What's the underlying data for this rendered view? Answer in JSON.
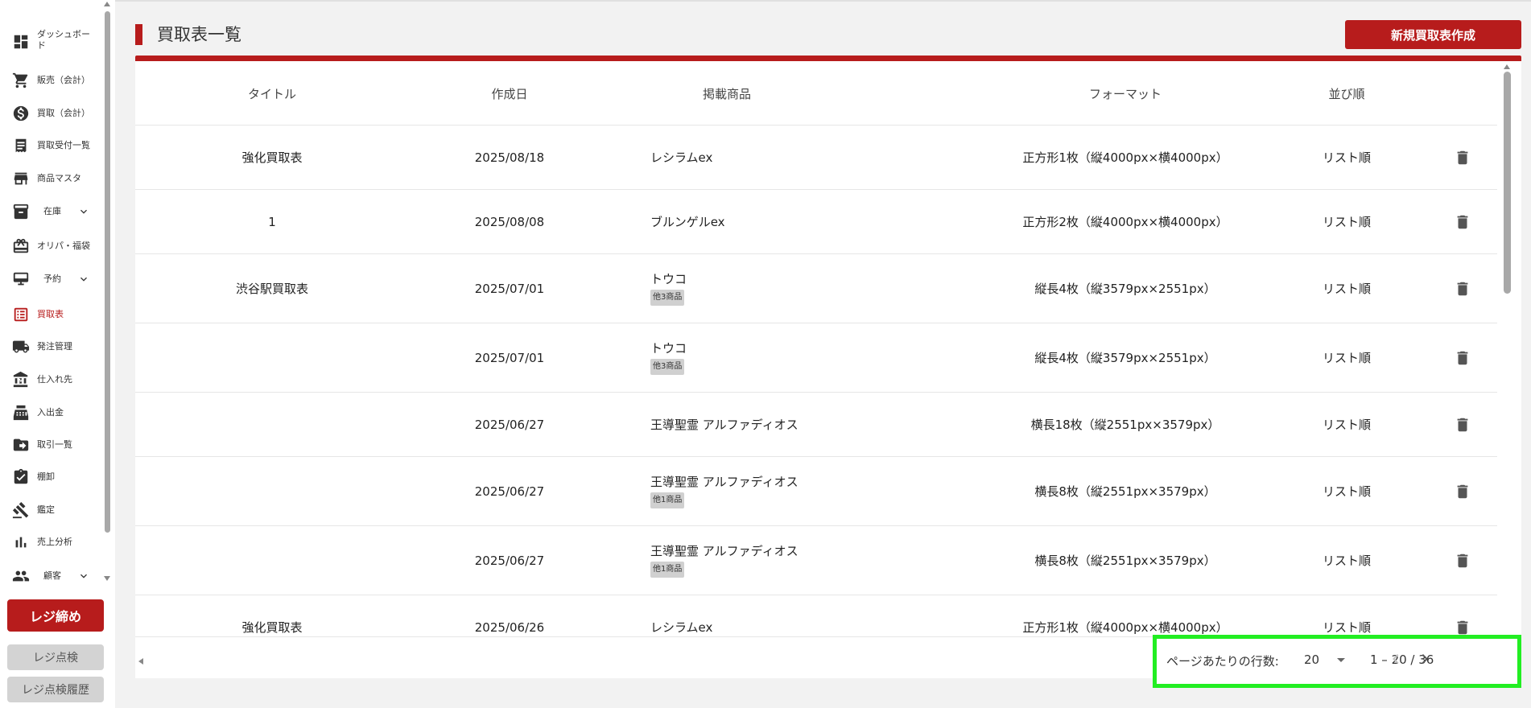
{
  "sidebar": {
    "items": [
      {
        "label": "ダッシュボード",
        "icon": "dashboard-icon",
        "active": false,
        "expandable": false
      },
      {
        "label": "販売（会計）",
        "icon": "cart-icon",
        "active": false,
        "expandable": false
      },
      {
        "label": "買取（会計）",
        "icon": "dollar-circle-icon",
        "active": false,
        "expandable": false
      },
      {
        "label": "買取受付一覧",
        "icon": "receipt-icon",
        "active": false,
        "expandable": false
      },
      {
        "label": "商品マスタ",
        "icon": "store-icon",
        "active": false,
        "expandable": false
      },
      {
        "label": "在庫",
        "icon": "inventory-box-icon",
        "active": false,
        "expandable": true
      },
      {
        "label": "オリパ・福袋",
        "icon": "gift-box-icon",
        "active": false,
        "expandable": false
      },
      {
        "label": "予約",
        "icon": "register-icon",
        "active": false,
        "expandable": true
      },
      {
        "label": "買取表",
        "icon": "list-table-icon",
        "active": true,
        "expandable": false
      },
      {
        "label": "発注管理",
        "icon": "truck-icon",
        "active": false,
        "expandable": false
      },
      {
        "label": "仕入れ先",
        "icon": "bank-icon",
        "active": false,
        "expandable": false
      },
      {
        "label": "入出金",
        "icon": "cash-register-icon",
        "active": false,
        "expandable": false
      },
      {
        "label": "取引一覧",
        "icon": "folder-arrow-icon",
        "active": false,
        "expandable": false
      },
      {
        "label": "棚卸",
        "icon": "clipboard-check-icon",
        "active": false,
        "expandable": false
      },
      {
        "label": "鑑定",
        "icon": "gavel-icon",
        "active": false,
        "expandable": false
      },
      {
        "label": "売上分析",
        "icon": "bar-chart-icon",
        "active": false,
        "expandable": false
      },
      {
        "label": "顧客",
        "icon": "people-icon",
        "active": false,
        "expandable": true
      }
    ],
    "close_register_label": "レジ締め",
    "register_check_label": "レジ点検",
    "register_check_history_label": "レジ点検履歴"
  },
  "header": {
    "title": "買取表一覧",
    "new_button_label": "新規買取表作成",
    "accent_color": "#b71c1c"
  },
  "table": {
    "columns": [
      "タイトル",
      "作成日",
      "掲載商品",
      "フォーマット",
      "並び順"
    ],
    "rows": [
      {
        "title": "強化買取表",
        "date": "2025/08/18",
        "product": "レシラムex",
        "badge": "",
        "format": "正方形1枚（縦4000px×横4000px）",
        "order": "リスト順"
      },
      {
        "title": "1",
        "date": "2025/08/08",
        "product": "ブルンゲルex",
        "badge": "",
        "format": "正方形2枚（縦4000px×横4000px）",
        "order": "リスト順"
      },
      {
        "title": "渋谷駅買取表",
        "date": "2025/07/01",
        "product": "トウコ",
        "badge": "他3商品",
        "format": "縦長4枚（縦3579px×2551px）",
        "order": "リスト順"
      },
      {
        "title": "",
        "date": "2025/07/01",
        "product": "トウコ",
        "badge": "他3商品",
        "format": "縦長4枚（縦3579px×2551px）",
        "order": "リスト順"
      },
      {
        "title": "",
        "date": "2025/06/27",
        "product": "王導聖霊 アルファディオス",
        "badge": "",
        "format": "横長18枚（縦2551px×3579px）",
        "order": "リスト順"
      },
      {
        "title": "",
        "date": "2025/06/27",
        "product": "王導聖霊 アルファディオス",
        "badge": "他1商品",
        "format": "横長8枚（縦2551px×3579px）",
        "order": "リスト順"
      },
      {
        "title": "",
        "date": "2025/06/27",
        "product": "王導聖霊 アルファディオス",
        "badge": "他1商品",
        "format": "横長8枚（縦2551px×3579px）",
        "order": "リスト順"
      },
      {
        "title": "強化買取表",
        "date": "2025/06/26",
        "product": "レシラムex",
        "badge": "",
        "format": "正方形1枚（縦4000px×横4000px）",
        "order": "リスト順"
      }
    ]
  },
  "pagination": {
    "rows_per_page_label": "ページあたりの行数:",
    "rows_per_page": "20",
    "range": "1 – 20 / 36",
    "highlight_color": "#22ee22"
  }
}
